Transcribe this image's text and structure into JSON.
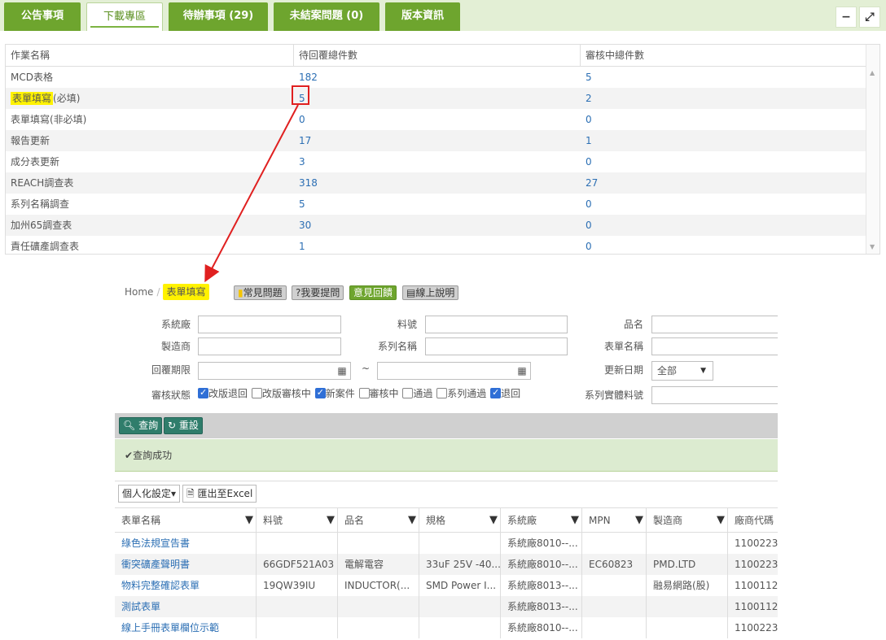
{
  "tabs": [
    {
      "label": "公告事項",
      "active": false
    },
    {
      "label": "下載專區",
      "active": true
    },
    {
      "label": "待辦事項 (29)",
      "active": false
    },
    {
      "label": "未結案問題 (0)",
      "active": false
    },
    {
      "label": "版本資訊",
      "active": false
    }
  ],
  "window": {
    "minimize": "−",
    "expand": "⤢"
  },
  "summary": {
    "headers": [
      "作業名稱",
      "待回覆總件數",
      "審核中總件數"
    ],
    "rows": [
      {
        "name": "MCD表格",
        "pending": "182",
        "review": "5"
      },
      {
        "name": "表單填寫(必填)",
        "name_hl": "表單填寫",
        "name_rest": "(必填)",
        "pending": "5",
        "review": "2"
      },
      {
        "name": "表單填寫(非必填)",
        "pending": "0",
        "review": "0"
      },
      {
        "name": "報告更新",
        "pending": "17",
        "review": "1"
      },
      {
        "name": "成分表更新",
        "pending": "3",
        "review": "0"
      },
      {
        "name": "REACH調查表",
        "pending": "318",
        "review": "27"
      },
      {
        "name": "系列名稱調查",
        "pending": "5",
        "review": "0"
      },
      {
        "name": "加州65調查表",
        "pending": "30",
        "review": "0"
      },
      {
        "name": "責任礦產調查表",
        "pending": "1",
        "review": "0"
      }
    ]
  },
  "breadcrumb": {
    "home": "Home",
    "sep": "/",
    "current": "表單填寫"
  },
  "helpButtons": {
    "faq": "常見問題",
    "ask": "?我要提問",
    "feedback": "意見回饋",
    "manual": "線上說明"
  },
  "form": {
    "labels": {
      "system_factory": "系統廠",
      "part_no": "料號",
      "product_name": "品名",
      "manufacturer": "製造商",
      "series_name": "系列名稱",
      "form_name": "表單名稱",
      "reply_deadline": "回覆期限",
      "tilde": "~",
      "update_date": "更新日期",
      "review_status": "審核狀態",
      "series_part": "系列實體料號"
    },
    "update_date_value": "全部",
    "statuses": [
      {
        "label": "改版退回",
        "checked": true
      },
      {
        "label": "改版審核中",
        "checked": false
      },
      {
        "label": "新案件",
        "checked": true
      },
      {
        "label": "審核中",
        "checked": false
      },
      {
        "label": "通過",
        "checked": false
      },
      {
        "label": "系列通過",
        "checked": false
      },
      {
        "label": "退回",
        "checked": true
      }
    ]
  },
  "actions": {
    "query": "查詢",
    "reset": "重設",
    "success": "查詢成功"
  },
  "gridTools": {
    "personal": "個人化設定▾",
    "export": "匯出至Excel"
  },
  "grid": {
    "headers": [
      "表單名稱",
      "料號",
      "品名",
      "規格",
      "系統廠",
      "MPN",
      "製造商",
      "廠商代碼"
    ],
    "rows": [
      [
        "綠色法規宣告書",
        "",
        "",
        "",
        "系統廠8010--...",
        "",
        "",
        "1100223"
      ],
      [
        "衝突礦產聲明書",
        "66GDF521A03",
        "電解電容",
        "33uF 25V -40...",
        "系統廠8010--...",
        "EC60823",
        "PMD.LTD",
        "1100223"
      ],
      [
        "物料完整確認表單",
        "19QW39IU",
        "INDUCTOR(...",
        "SMD Power I...",
        "系統廠8013--...",
        "",
        "融易網路(股)",
        "1100112"
      ],
      [
        "測試表單",
        "",
        "",
        "",
        "系統廠8013--...",
        "",
        "",
        "1100112"
      ],
      [
        "線上手冊表單欄位示範",
        "",
        "",
        "",
        "系統廠8010--...",
        "",
        "",
        "1100223"
      ]
    ]
  },
  "colors": {
    "brand_green": "#6ea52e",
    "highlight": "#fff200",
    "link": "#2c6fb4",
    "annotation_red": "#e02020"
  }
}
